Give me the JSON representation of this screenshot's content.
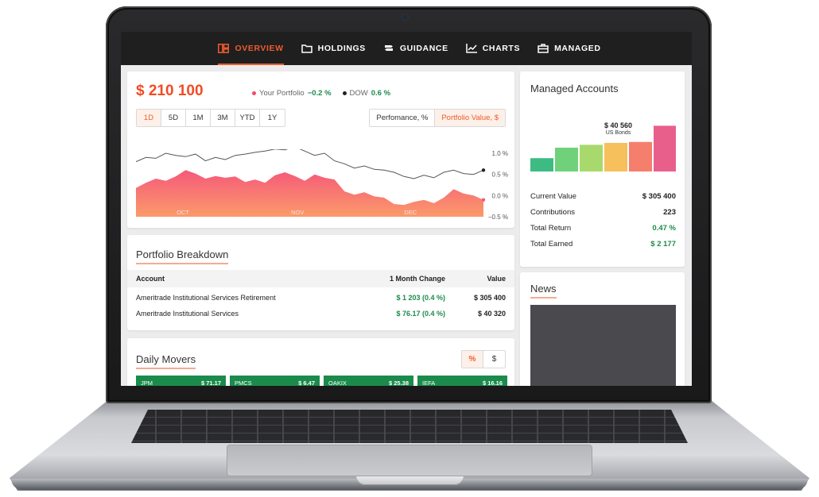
{
  "nav": {
    "items": [
      {
        "label": "OVERVIEW",
        "active": true,
        "icon": "dashboard-icon"
      },
      {
        "label": "HOLDINGS",
        "active": false,
        "icon": "folder-icon"
      },
      {
        "label": "GUIDANCE",
        "active": false,
        "icon": "signpost-icon"
      },
      {
        "label": "CHARTS",
        "active": false,
        "icon": "line-chart-icon"
      },
      {
        "label": "MANAGED",
        "active": false,
        "icon": "briefcase-icon"
      }
    ]
  },
  "portfolio": {
    "value": "$ 210 100",
    "legend_portfolio_label": "Your Portfolio",
    "legend_portfolio_value": "−0.2 %",
    "legend_dow_label": "DOW",
    "legend_dow_value": "0.6 %",
    "ranges": [
      "1D",
      "5D",
      "1M",
      "3M",
      "YTD",
      "1Y"
    ],
    "active_range": "1D",
    "mode_performance": "Perfomance, %",
    "mode_value": "Portfolio Value, $",
    "colors": {
      "accent": "#ef5b2f",
      "positive": "#1b8b4c"
    }
  },
  "chart_data": {
    "type": "area",
    "x_tick_labels": [
      "OCT",
      "NOV",
      "DEC"
    ],
    "y_tick_labels": [
      "1.0 %",
      "0.5 %",
      "0.0 %",
      "−0.5 %"
    ],
    "ylim": [
      -0.5,
      1.0
    ],
    "series": [
      {
        "name": "Your Portfolio",
        "style": "area",
        "color": "#f56a7a",
        "values": [
          0.18,
          0.3,
          0.4,
          0.35,
          0.45,
          0.6,
          0.52,
          0.4,
          0.46,
          0.42,
          0.45,
          0.32,
          0.38,
          0.3,
          0.48,
          0.55,
          0.46,
          0.35,
          0.5,
          0.42,
          0.38,
          0.1,
          0.02,
          0.08,
          -0.02,
          -0.05,
          -0.2,
          -0.22,
          -0.15,
          -0.1,
          -0.18,
          -0.05,
          0.15,
          0.05,
          0.0,
          -0.1
        ]
      },
      {
        "name": "DOW",
        "style": "line",
        "color": "#555555",
        "values": [
          0.8,
          0.9,
          0.88,
          1.0,
          0.95,
          0.92,
          0.98,
          0.82,
          0.9,
          0.85,
          0.95,
          0.98,
          1.02,
          1.05,
          1.1,
          1.08,
          1.15,
          1.05,
          0.95,
          1.0,
          0.82,
          0.75,
          0.65,
          0.7,
          0.62,
          0.6,
          0.55,
          0.45,
          0.4,
          0.48,
          0.42,
          0.55,
          0.6,
          0.52,
          0.5,
          0.6
        ]
      }
    ]
  },
  "breakdown": {
    "title": "Portfolio Breakdown",
    "headers": [
      "Account",
      "1 Month Change",
      "Value"
    ],
    "rows": [
      [
        "Ameritrade Institutional Services Retirement",
        "$ 1 203 (0.4 %)",
        "$ 305 400"
      ],
      [
        "Ameritrade Institutional Services",
        "$ 76.17 (0.4 %)",
        "$ 40 320"
      ]
    ]
  },
  "movers": {
    "title": "Daily Movers",
    "toggle_percent": "%",
    "toggle_dollar": "$",
    "items": [
      {
        "ticker": "JPM",
        "price": "$ 71.17"
      },
      {
        "ticker": "PMCS",
        "price": "$ 6.47"
      },
      {
        "ticker": "OAKIX",
        "price": "$ 25.38"
      },
      {
        "ticker": "IEFA",
        "price": "$ 16.16"
      }
    ]
  },
  "managed": {
    "title": "Managed Accounts",
    "bar_value": "$ 40 560",
    "bar_caption": "US Bonds",
    "bars": [
      0.28,
      0.5,
      0.56,
      0.6,
      0.62,
      0.96
    ],
    "bar_colors": [
      "#3dbb83",
      "#6fd17a",
      "#a8d96c",
      "#f6c05c",
      "#f57f6c",
      "#e95f8c"
    ],
    "rows": [
      {
        "label": "Current Value",
        "value": "$ 305 400"
      },
      {
        "label": "Contributions",
        "value": "223"
      },
      {
        "label": "Total Return",
        "value": "0.47 %"
      },
      {
        "label": "Total Earned",
        "value": "$ 2 177"
      }
    ]
  },
  "news": {
    "title": "News"
  }
}
